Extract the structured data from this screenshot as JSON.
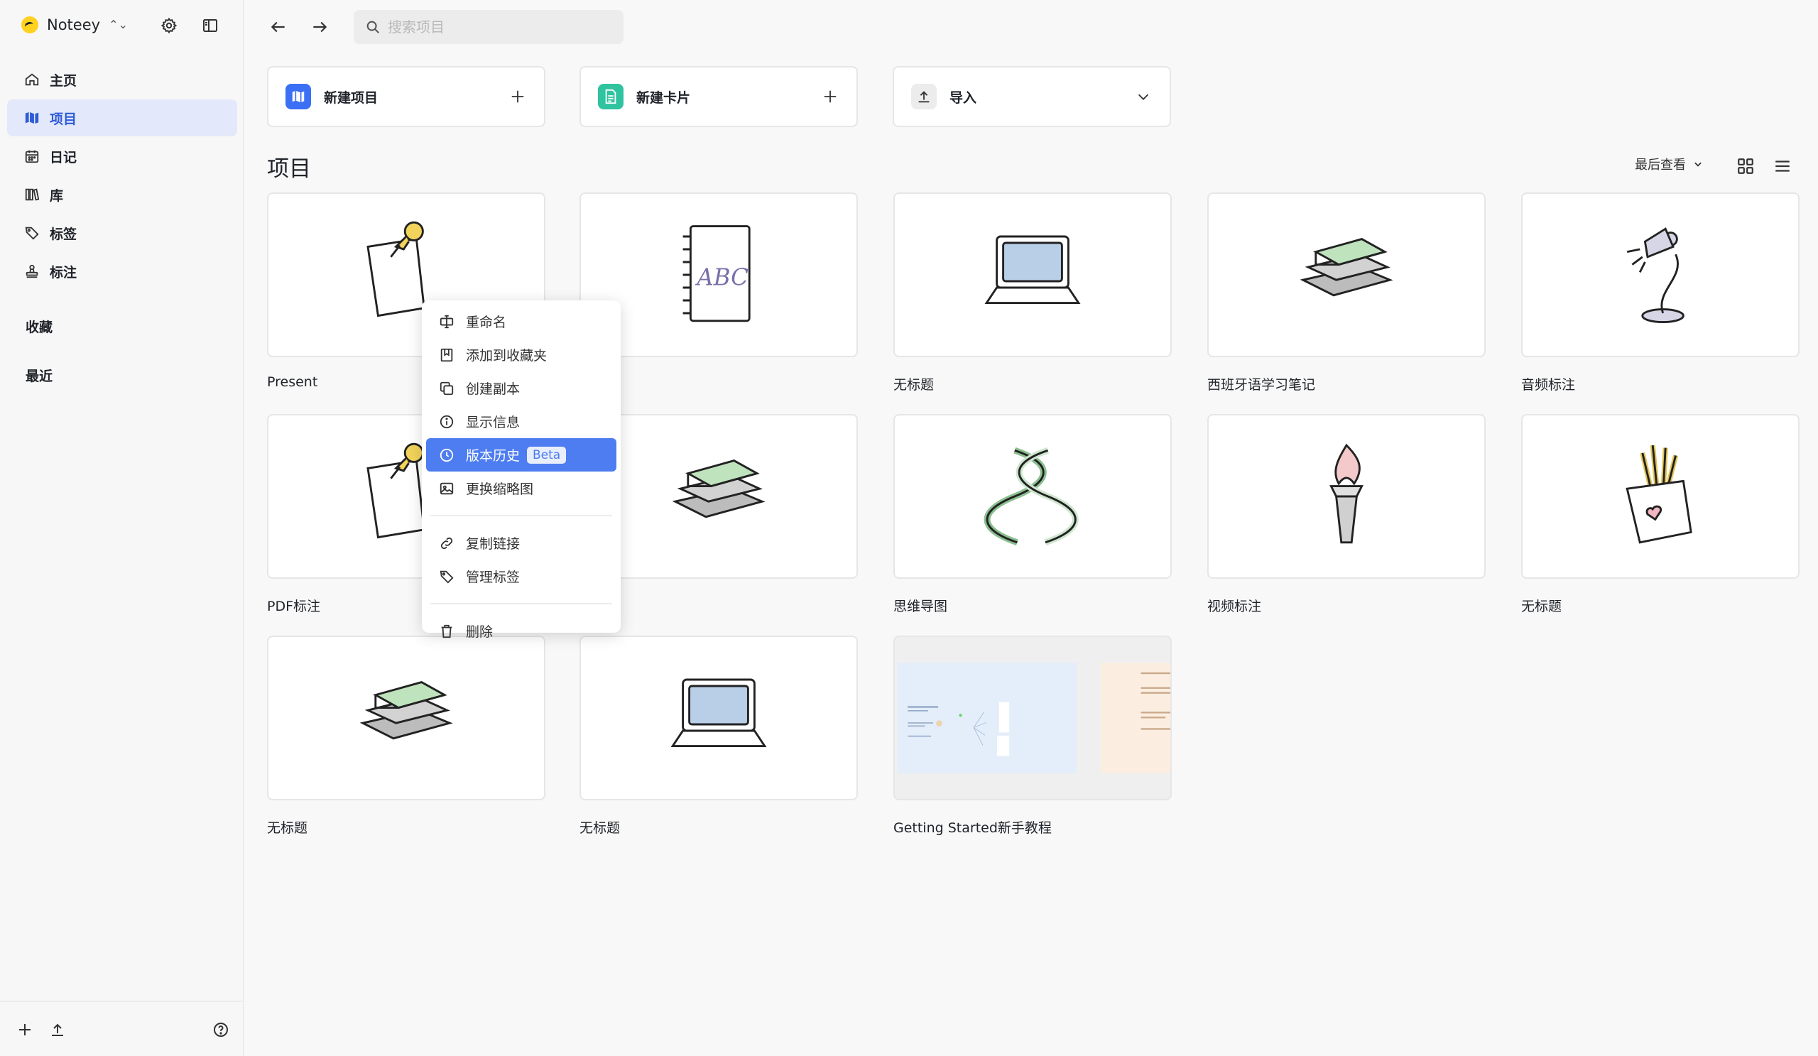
{
  "app": {
    "name": "Noteey"
  },
  "sidebar": {
    "items": [
      {
        "label": "主页",
        "icon": "home-icon"
      },
      {
        "label": "项目",
        "icon": "map-icon",
        "active": true
      },
      {
        "label": "日记",
        "icon": "calendar-icon"
      },
      {
        "label": "库",
        "icon": "library-icon"
      },
      {
        "label": "标签",
        "icon": "tag-icon"
      },
      {
        "label": "标注",
        "icon": "stamp-icon"
      }
    ],
    "favorites_label": "收藏",
    "recent_label": "最近"
  },
  "search": {
    "placeholder": "搜索项目"
  },
  "actions": {
    "new_project": "新建项目",
    "new_card": "新建卡片",
    "import": "导入"
  },
  "main": {
    "title": "项目",
    "sort_label": "最后查看"
  },
  "projects": [
    {
      "name": "Present",
      "thumb": "pinned-note"
    },
    {
      "name": "",
      "thumb": "abc-notebook"
    },
    {
      "name": "无标题",
      "thumb": "laptop"
    },
    {
      "name": "西班牙语学习笔记",
      "thumb": "books"
    },
    {
      "name": "音频标注",
      "thumb": "desk-lamp"
    },
    {
      "name": "PDF标注",
      "thumb": "pinned-note"
    },
    {
      "name": "",
      "thumb": "books"
    },
    {
      "name": "思维导图",
      "thumb": "dna"
    },
    {
      "name": "视频标注",
      "thumb": "torch"
    },
    {
      "name": "无标题",
      "thumb": "pencil-cup"
    },
    {
      "name": "无标题",
      "thumb": "books"
    },
    {
      "name": "无标题",
      "thumb": "laptop"
    },
    {
      "name": "Getting Started新手教程",
      "thumb": "screenshot-preview"
    }
  ],
  "context_menu": {
    "items": [
      {
        "label": "重命名",
        "icon": "rename-icon"
      },
      {
        "label": "添加到收藏夹",
        "icon": "bookmark-icon"
      },
      {
        "label": "创建副本",
        "icon": "copy-icon"
      },
      {
        "label": "显示信息",
        "icon": "info-icon"
      },
      {
        "label": "版本历史",
        "icon": "history-icon",
        "badge": "Beta",
        "active": true
      },
      {
        "label": "更换缩略图",
        "icon": "image-icon"
      },
      {
        "label": "复制链接",
        "icon": "link-icon"
      },
      {
        "label": "管理标签",
        "icon": "tag-icon"
      },
      {
        "label": "删除",
        "icon": "trash-icon"
      }
    ]
  },
  "colors": {
    "accent": "#4d7df0",
    "active_nav_bg": "#e3e9fa",
    "new_project_icon": "#3b6ff5",
    "new_card_icon": "#2fc3a0"
  }
}
